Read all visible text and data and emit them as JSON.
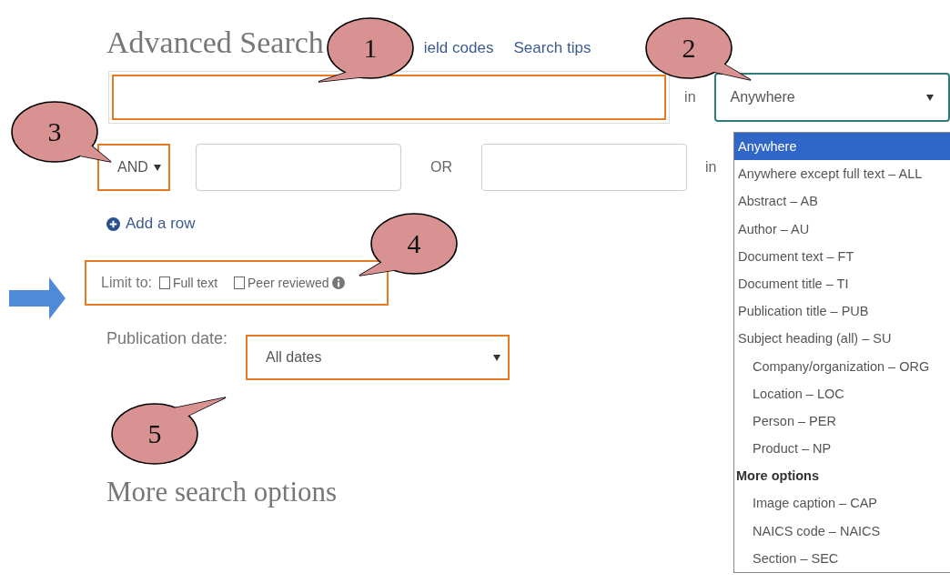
{
  "title": "Advanced Search",
  "header_links": [
    {
      "label": "ield codes"
    },
    {
      "label": "Search tips"
    }
  ],
  "row_1": {
    "in_label": "in",
    "field_select": "Anywhere"
  },
  "row_2": {
    "operator": "AND",
    "or_label": "OR",
    "in_label": "in"
  },
  "add_row": "Add a row",
  "limit_to": {
    "label": "Limit to:",
    "options": [
      {
        "label": "Full text",
        "checked": false,
        "info": false
      },
      {
        "label": "Peer reviewed",
        "checked": false,
        "info": true
      }
    ]
  },
  "publication_date": {
    "label": "Publication date:",
    "value": "All dates"
  },
  "more_heading": "More search options",
  "field_menu": [
    {
      "kind": "option",
      "label": "Anywhere",
      "selected": true
    },
    {
      "kind": "option",
      "label": "Anywhere except full text – ALL",
      "selected": false
    },
    {
      "kind": "option",
      "label": "Abstract – AB",
      "selected": false
    },
    {
      "kind": "option",
      "label": "Author – AU",
      "selected": false
    },
    {
      "kind": "option",
      "label": "Document text – FT",
      "selected": false
    },
    {
      "kind": "option",
      "label": "Document title – TI",
      "selected": false
    },
    {
      "kind": "option",
      "label": "Publication title – PUB",
      "selected": false
    },
    {
      "kind": "option",
      "label": "Subject heading (all) – SU",
      "selected": false,
      "children": [
        {
          "kind": "option",
          "label": "Company/organization – ORG",
          "selected": false
        },
        {
          "kind": "option",
          "label": "Location – LOC",
          "selected": false
        },
        {
          "kind": "option",
          "label": "Person – PER",
          "selected": false
        },
        {
          "kind": "option",
          "label": "Product – NP",
          "selected": false
        }
      ]
    },
    {
      "kind": "group",
      "label": "More options",
      "children": [
        {
          "kind": "option",
          "label": "Image caption – CAP",
          "selected": false
        },
        {
          "kind": "option",
          "label": "NAICS code – NAICS",
          "selected": false
        },
        {
          "kind": "option",
          "label": "Section – SEC",
          "selected": false
        }
      ]
    }
  ],
  "callouts": [
    {
      "label": "1"
    },
    {
      "label": "2"
    },
    {
      "label": "3"
    },
    {
      "label": "4"
    },
    {
      "label": "5"
    }
  ]
}
